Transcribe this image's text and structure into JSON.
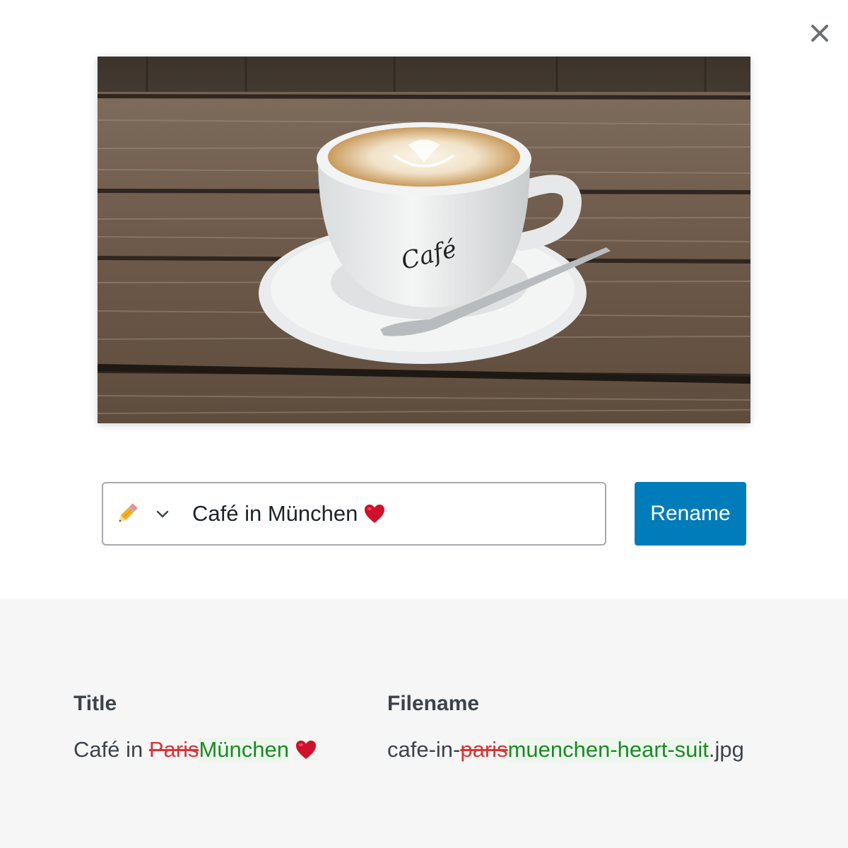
{
  "dialog": {
    "close_icon": "close-icon",
    "photo": {
      "description_icon": "coffee-photo",
      "cup_text": "Café"
    }
  },
  "rename": {
    "mode_icon": "pencil-icon",
    "mode_dropdown_icon": "chevron-down-icon",
    "title_value": "Café in München",
    "title_emoji": "heart-icon",
    "button_label": "Rename",
    "accent_color": "#007cba"
  },
  "preview": {
    "title": {
      "heading": "Title",
      "prefix": "Café in ",
      "removed": "Paris",
      "added": "München",
      "suffix_icon": "heart-icon"
    },
    "filename": {
      "heading": "Filename",
      "prefix": "cafe-in-",
      "removed": "paris",
      "added": "muenchen-heart-suit",
      "suffix": ".jpg"
    },
    "colors": {
      "removed": "#d63638",
      "added": "#1a8a24"
    }
  }
}
